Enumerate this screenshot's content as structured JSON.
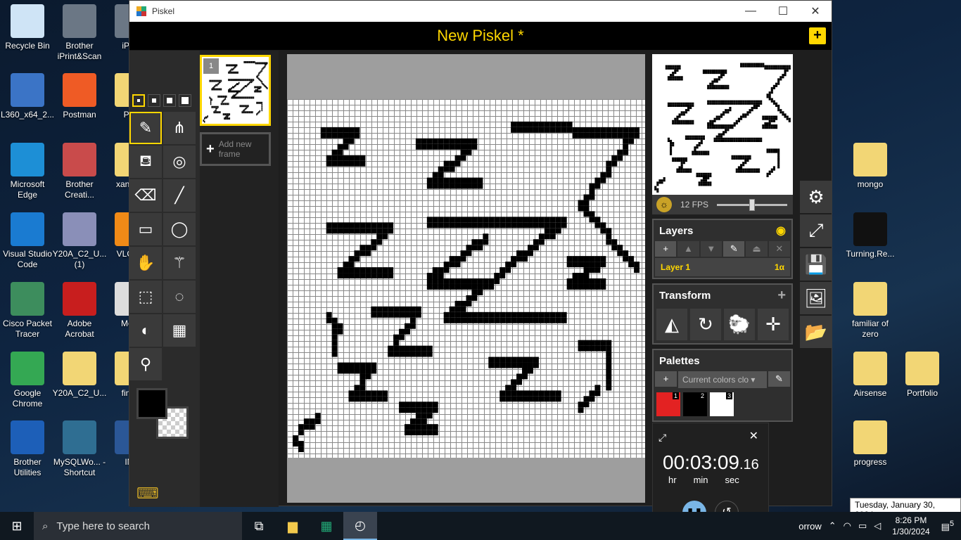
{
  "desktop_icons": [
    {
      "label": "Recycle Bin",
      "color": "#cfe4f6"
    },
    {
      "label": "Brother iPrint&Scan",
      "color": "#6b7785"
    },
    {
      "label": "iPrint",
      "color": "#6b7785"
    },
    {
      "label": "L360_x64_2...",
      "color": "#3b74c6"
    },
    {
      "label": "Postman",
      "color": "#ef5b25"
    },
    {
      "label": "Pisk",
      "color": "#f2d675"
    },
    {
      "label": "Microsoft Edge",
      "color": "#1d8fd6"
    },
    {
      "label": "Brother Creati...",
      "color": "#c94b4b"
    },
    {
      "label": "xan Sho",
      "color": "#f2d675"
    },
    {
      "label": "Visual Studio Code",
      "color": "#1a7bd1"
    },
    {
      "label": "Y20A_C2_U... (1)",
      "color": "#8a8fb8"
    },
    {
      "label": "VLC pla",
      "color": "#f08a17"
    },
    {
      "label": "Cisco Packet Tracer",
      "color": "#3d8d5d"
    },
    {
      "label": "Adobe Acrobat",
      "color": "#c81e1e"
    },
    {
      "label": "Mong",
      "color": "#dddddd"
    },
    {
      "label": "Google Chrome",
      "color": "#34a853"
    },
    {
      "label": "Y20A_C2_U...",
      "color": "#f2d675"
    },
    {
      "label": "finalp",
      "color": "#f2d675"
    },
    {
      "label": "Brother Utilities",
      "color": "#1d5fb8"
    },
    {
      "label": "MySQLWo... - Shortcut",
      "color": "#2f6e92"
    },
    {
      "label": "INT",
      "color": "#2b5797"
    },
    {
      "label": "mongo",
      "color": "#f2d675"
    },
    {
      "label": "Turning.Re...",
      "color": "#111111"
    },
    {
      "label": "familiar of zero",
      "color": "#f2d675"
    },
    {
      "label": "Airsense",
      "color": "#f2d675"
    },
    {
      "label": "Portfolio",
      "color": "#f2d675"
    },
    {
      "label": "progress",
      "color": "#f2d675"
    }
  ],
  "window": {
    "app_title": "Piskel",
    "doc_title": "New Piskel *",
    "minimize": "—",
    "maximize": "☐",
    "close": "✕"
  },
  "tools": {
    "pen_sizes": [
      1,
      2,
      3,
      4
    ],
    "selected_pen_size": 1,
    "items": [
      {
        "name": "pen-tool",
        "glyph": "✎",
        "selected": true
      },
      {
        "name": "vertical-mirror-pen-tool",
        "glyph": "⋔",
        "selected": false
      },
      {
        "name": "paint-bucket-tool",
        "glyph": "⛾",
        "selected": false
      },
      {
        "name": "paint-same-color-tool",
        "glyph": "◎",
        "selected": false
      },
      {
        "name": "eraser-tool",
        "glyph": "⌫",
        "selected": false
      },
      {
        "name": "stroke-tool",
        "glyph": "╱",
        "selected": false
      },
      {
        "name": "rectangle-tool",
        "glyph": "▭",
        "selected": false
      },
      {
        "name": "circle-tool",
        "glyph": "◯",
        "selected": false
      },
      {
        "name": "move-tool",
        "glyph": "✋",
        "selected": false
      },
      {
        "name": "shape-selection-tool",
        "glyph": "⚚",
        "selected": false
      },
      {
        "name": "rectangle-selection-tool",
        "glyph": "⬚",
        "selected": false
      },
      {
        "name": "lasso-selection-tool",
        "glyph": "◌",
        "selected": false
      },
      {
        "name": "lighten-tool",
        "glyph": "◐",
        "selected": false
      },
      {
        "name": "dithering-tool",
        "glyph": "▦",
        "selected": false
      },
      {
        "name": "color-picker-tool",
        "glyph": "⚲",
        "selected": false
      }
    ],
    "primary_color": "#000000",
    "secondary_color": "transparent",
    "keyboard_glyph": "⌨"
  },
  "frames": {
    "frame_number": "1",
    "add_frame_label": "Add new frame"
  },
  "preview": {
    "fps_label": "12 FPS",
    "fps_value": 12
  },
  "layers": {
    "title": "Layers",
    "eye_glyph": "👁",
    "tools": [
      {
        "glyph": "+",
        "dim": false
      },
      {
        "glyph": "▲",
        "dim": true
      },
      {
        "glyph": "▼",
        "dim": true
      },
      {
        "glyph": "✎",
        "dim": false
      },
      {
        "glyph": "⏏",
        "dim": true
      },
      {
        "glyph": "✕",
        "dim": true
      }
    ],
    "items": [
      {
        "name": "Layer 1",
        "opacity": "1α"
      }
    ]
  },
  "transform": {
    "title": "Transform",
    "add": "+",
    "tools": [
      {
        "name": "flip-icon",
        "glyph": "◭"
      },
      {
        "name": "rotate-icon",
        "glyph": "↻"
      },
      {
        "name": "clone-sheep-icon",
        "glyph": "🐑"
      },
      {
        "name": "align-center-icon",
        "glyph": "✛"
      }
    ]
  },
  "palettes": {
    "title": "Palettes",
    "add": "+",
    "selected": "Current colors clo",
    "dropdown": "▾",
    "edit": "✎",
    "swatches": [
      {
        "n": "1",
        "color": "#e32222"
      },
      {
        "n": "2",
        "color": "#000000"
      },
      {
        "n": "3",
        "color": "#ffffff"
      }
    ]
  },
  "side_actions": [
    {
      "name": "settings-icon",
      "glyph": "⚙"
    },
    {
      "name": "resize-icon",
      "glyph": "⤢"
    },
    {
      "name": "save-icon",
      "glyph": "💾"
    },
    {
      "name": "export-image-icon",
      "glyph": "🖼"
    },
    {
      "name": "open-folder-icon",
      "glyph": "📂"
    }
  ],
  "timer": {
    "time": "00:03:09",
    "fraction": ".16",
    "hr": "hr",
    "min": "min",
    "sec": "sec",
    "pause": "❚❚",
    "reset": "↺",
    "close": "✕",
    "expand": "⤢"
  },
  "tooltip": "Tuesday, January 30, 2024",
  "taskbar": {
    "start_glyph": "⊞",
    "search_placeholder": "Type here to search",
    "weather_text": "orrow",
    "time": "8:26 PM",
    "date": "1/30/2024",
    "notifications": "5"
  }
}
